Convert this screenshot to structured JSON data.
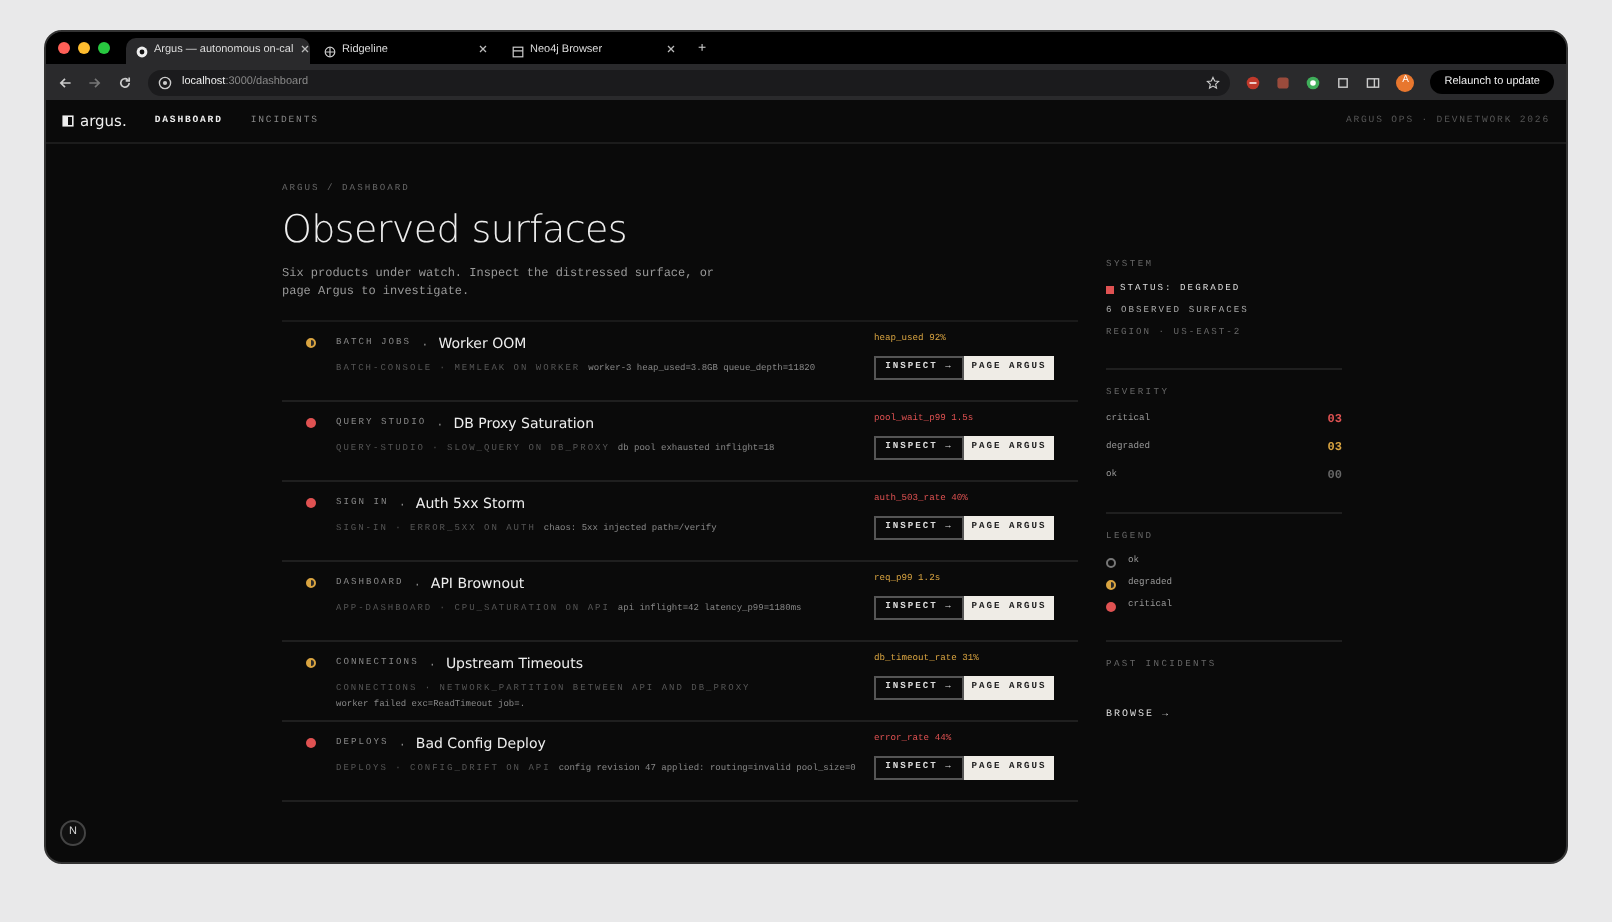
{
  "browser": {
    "tabs": [
      {
        "title": "Argus — autonomous on-cal",
        "selected": true,
        "kind": "app"
      },
      {
        "title": "Ridgeline",
        "selected": false,
        "kind": "globe"
      },
      {
        "title": "Neo4j Browser",
        "selected": false,
        "kind": "page"
      }
    ],
    "new_tab": "+",
    "url_host": "localhost",
    "url_path": ":3000/dashboard",
    "avatar": "A",
    "relaunch": "Relaunch to update"
  },
  "app": {
    "brand": "argus.",
    "nav": [
      {
        "label": "DASHBOARD",
        "selected": true
      },
      {
        "label": "INCIDENTS",
        "selected": false
      }
    ],
    "header_right": "ARGUS OPS · DEVNETWORK 2026",
    "breadcrumb": "ARGUS / DASHBOARD",
    "title": "Observed surfaces",
    "description": "Six products under watch. Inspect the distressed surface, or page Argus to investigate."
  },
  "incidents": [
    {
      "kind": "degraded",
      "separator": "·",
      "product": "BATCH JOBS",
      "title": "Worker OOM",
      "source": "BATCH-CONSOLE · MEMLEAK ON WORKER",
      "detail": "worker-3 heap_used=3.8GB queue_depth=11820",
      "metric": "heap_used 92%",
      "actions": [
        "INSPECT →",
        "PAGE ARGUS"
      ]
    },
    {
      "kind": "critical",
      "separator": "·",
      "product": "QUERY STUDIO",
      "title": "DB Proxy Saturation",
      "source": "QUERY-STUDIO · SLOW_QUERY ON DB_PROXY",
      "detail": "db pool exhausted inflight=18",
      "metric": "pool_wait_p99 1.5s",
      "actions": [
        "INSPECT →",
        "PAGE ARGUS"
      ]
    },
    {
      "kind": "critical",
      "separator": "·",
      "product": "SIGN IN",
      "title": "Auth 5xx Storm",
      "source": "SIGN-IN · ERROR_5XX ON AUTH",
      "detail": "chaos: 5xx injected path=/verify",
      "metric": "auth_503_rate 40%",
      "actions": [
        "INSPECT →",
        "PAGE ARGUS"
      ]
    },
    {
      "kind": "degraded",
      "separator": "·",
      "product": "DASHBOARD",
      "title": "API Brownout",
      "source": "APP-DASHBOARD · CPU_SATURATION ON API",
      "detail": "api inflight=42 latency_p99=1180ms",
      "metric": "req_p99 1.2s",
      "actions": [
        "INSPECT →",
        "PAGE ARGUS"
      ]
    },
    {
      "kind": "degraded",
      "separator": "·",
      "product": "CONNECTIONS",
      "title": "Upstream Timeouts",
      "source": "CONNECTIONS · NETWORK_PARTITION BETWEEN API AND DB_PROXY",
      "detail": "worker failed exc=ReadTimeout job=.",
      "metric": "db_timeout_rate 31%",
      "actions": [
        "INSPECT →",
        "PAGE ARGUS"
      ]
    },
    {
      "kind": "critical",
      "separator": "·",
      "product": "DEPLOYS",
      "title": "Bad Config Deploy",
      "source": "DEPLOYS · CONFIG_DRIFT ON API",
      "detail": "config revision 47 applied: routing=invalid pool_size=0",
      "metric": "error_rate 44%",
      "actions": [
        "INSPECT →",
        "PAGE ARGUS"
      ]
    }
  ],
  "sidebar": {
    "system_heading": "SYSTEM",
    "status": {
      "label": "STATUS: DEGRADED",
      "color": "#e05252"
    },
    "surfaces": "6 OBSERVED SURFACES",
    "region": "REGION · US-EAST-2",
    "severity_heading": "SEVERITY",
    "severity_counts": [
      {
        "label": "critical",
        "count": "03",
        "kind": "critical"
      },
      {
        "label": "degraded",
        "count": "03",
        "kind": "degraded"
      },
      {
        "label": "ok",
        "count": "00",
        "kind": "ok"
      }
    ],
    "legend_heading": "LEGEND",
    "legend": [
      {
        "label": "ok",
        "kind": "ok"
      },
      {
        "label": "degraded",
        "kind": "degraded"
      },
      {
        "label": "critical",
        "kind": "critical"
      }
    ],
    "past_heading": "PAST INCIDENTS",
    "browse": "BROWSE →"
  },
  "dev_badge": "N"
}
